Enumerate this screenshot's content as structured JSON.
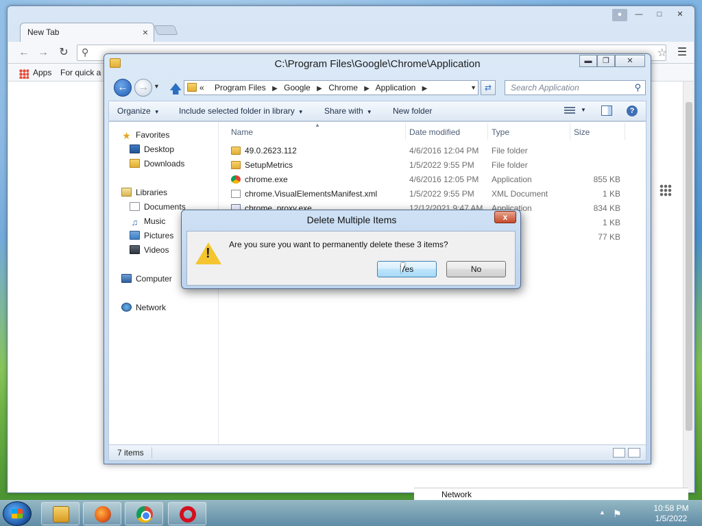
{
  "chrome": {
    "tab_title": "New Tab",
    "tab_close": "×",
    "bookmark_apps": "Apps",
    "bookmark_quick": "For quick ac"
  },
  "explorer": {
    "title": "C:\\Program Files\\Google\\Chrome\\Application",
    "breadcrumb_prefix": "«",
    "breadcrumbs": [
      "Program Files",
      "Google",
      "Chrome",
      "Application"
    ],
    "search_placeholder": "Search Application",
    "commands": {
      "organize": "Organize",
      "include": "Include selected folder in library",
      "share": "Share with",
      "new_folder": "New folder"
    },
    "nav": {
      "favorites": "Favorites",
      "desktop": "Desktop",
      "downloads": "Downloads",
      "libraries": "Libraries",
      "documents": "Documents",
      "music": "Music",
      "pictures": "Pictures",
      "videos": "Videos",
      "computer": "Computer",
      "network": "Network"
    },
    "columns": {
      "name": "Name",
      "date": "Date modified",
      "type": "Type",
      "size": "Size"
    },
    "files": [
      {
        "name": "49.0.2623.112",
        "date": "4/6/2016 12:04 PM",
        "type": "File folder",
        "size": "",
        "icon": "folder-icon"
      },
      {
        "name": "SetupMetrics",
        "date": "1/5/2022 9:55 PM",
        "type": "File folder",
        "size": "",
        "icon": "folder-icon"
      },
      {
        "name": "chrome.exe",
        "date": "4/6/2016 12:05 PM",
        "type": "Application",
        "size": "855 KB",
        "icon": "chrome-icon"
      },
      {
        "name": "chrome.VisualElementsManifest.xml",
        "date": "1/5/2022 9:55 PM",
        "type": "XML Document",
        "size": "1 KB",
        "icon": "xml-file-icon"
      },
      {
        "name": "chrome_proxy.exe",
        "date": "12/12/2021 9:47 AM",
        "type": "Application",
        "size": "834 KB",
        "icon": "exe-file-icon"
      },
      {
        "name": "",
        "date": "",
        "type": "",
        "size": "1 KB",
        "icon": ""
      },
      {
        "name": "",
        "date": "",
        "type": "ation",
        "size": "77 KB",
        "icon": ""
      }
    ],
    "status_count": "7 items"
  },
  "dialog": {
    "title": "Delete Multiple Items",
    "close": "x",
    "message": "Are you sure you want to permanently delete these 3 items?",
    "yes_label": "Yes",
    "no_label": "No"
  },
  "behind": {
    "network_label": "Network"
  },
  "taskbar": {
    "time": "10:58 PM",
    "date": "1/5/2022"
  }
}
